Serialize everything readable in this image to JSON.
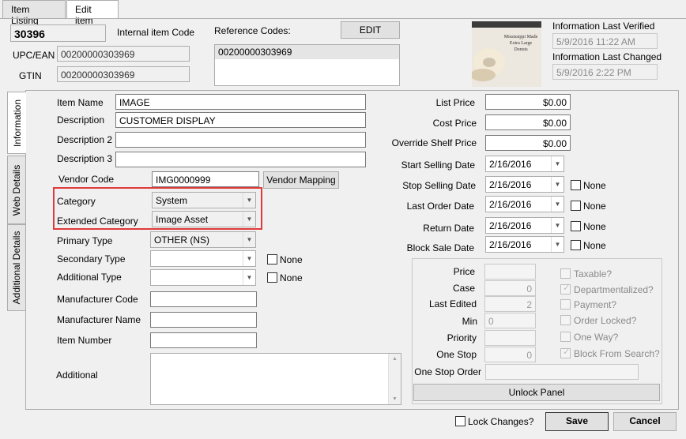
{
  "tabs": [
    "Item Listing",
    "Edit item"
  ],
  "header": {
    "item_code": "30396",
    "internal_code_label": "Internal item Code",
    "upc_label": "UPC/EAN",
    "upc_value": "00200000303969",
    "gtin_label": "GTIN",
    "gtin_value": "00200000303969",
    "reference_codes_label": "Reference Codes:",
    "edit_button": "EDIT",
    "reference_codes": [
      "00200000303969"
    ],
    "image_caption_lines": [
      "Mississippi Made",
      "Extra Large",
      "Donuts"
    ],
    "last_verified_label": "Information Last Verified",
    "last_verified_value": "5/9/2016 11:22 AM",
    "last_changed_label": "Information Last Changed",
    "last_changed_value": "5/9/2016 2:22 PM"
  },
  "side_tabs": [
    "Information",
    "Web Details",
    "Additional Details"
  ],
  "left_fields": {
    "item_name_label": "Item Name",
    "item_name_value": "IMAGE",
    "description_label": "Description",
    "description_value": "CUSTOMER DISPLAY",
    "description2_label": "Description 2",
    "description2_value": "",
    "description3_label": "Description 3",
    "description3_value": "",
    "vendor_code_label": "Vendor Code",
    "vendor_code_value": "IMG0000999",
    "vendor_mapping_button": "Vendor Mapping",
    "category_label": "Category",
    "category_value": "System",
    "ext_category_label": "Extended Category",
    "ext_category_value": "Image Asset",
    "primary_type_label": "Primary Type",
    "primary_type_value": "OTHER (NS)",
    "secondary_type_label": "Secondary Type",
    "secondary_type_value": "",
    "additional_type_label": "Additional Type",
    "additional_type_value": "",
    "none_label": "None",
    "manufacturer_code_label": "Manufacturer Code",
    "manufacturer_name_label": "Manufacturer Name",
    "item_number_label": "Item Number",
    "additional_label": "Additional"
  },
  "right_fields": {
    "list_price_label": "List Price",
    "list_price_value": "$0.00",
    "cost_price_label": "Cost Price",
    "cost_price_value": "$0.00",
    "override_label": "Override Shelf Price",
    "override_value": "$0.00",
    "start_selling_label": "Start Selling Date",
    "start_selling_value": "2/16/2016",
    "stop_selling_label": "Stop Selling Date",
    "stop_selling_value": "2/16/2016",
    "last_order_label": "Last Order Date",
    "last_order_value": "2/16/2016",
    "return_label": "Return Date",
    "return_value": "2/16/2016",
    "block_sale_label": "Block Sale Date",
    "block_sale_value": "2/16/2016",
    "none_label": "None"
  },
  "locked_panel": {
    "price_label": "Price",
    "price_value": "",
    "case_label": "Case",
    "case_value": "0",
    "last_edited_label": "Last Edited",
    "last_edited_value": "2",
    "min_label": "Min",
    "min_value": "0",
    "priority_label": "Priority",
    "priority_value": "",
    "one_stop_label": "One Stop",
    "one_stop_value": "0",
    "one_stop_order_label": "One Stop Order",
    "one_stop_order_value": "",
    "taxable_label": "Taxable?",
    "departmentalized_label": "Departmentalized?",
    "payment_label": "Payment?",
    "order_locked_label": "Order Locked?",
    "one_way_label": "One Way?",
    "block_search_label": "Block From Search?",
    "unlock_button": "Unlock Panel"
  },
  "footer": {
    "lock_changes_label": "Lock Changes?",
    "save_button": "Save",
    "cancel_button": "Cancel"
  },
  "colors": {
    "highlight_red": "#e03a3a",
    "dim_text": "#8a8a8a"
  }
}
